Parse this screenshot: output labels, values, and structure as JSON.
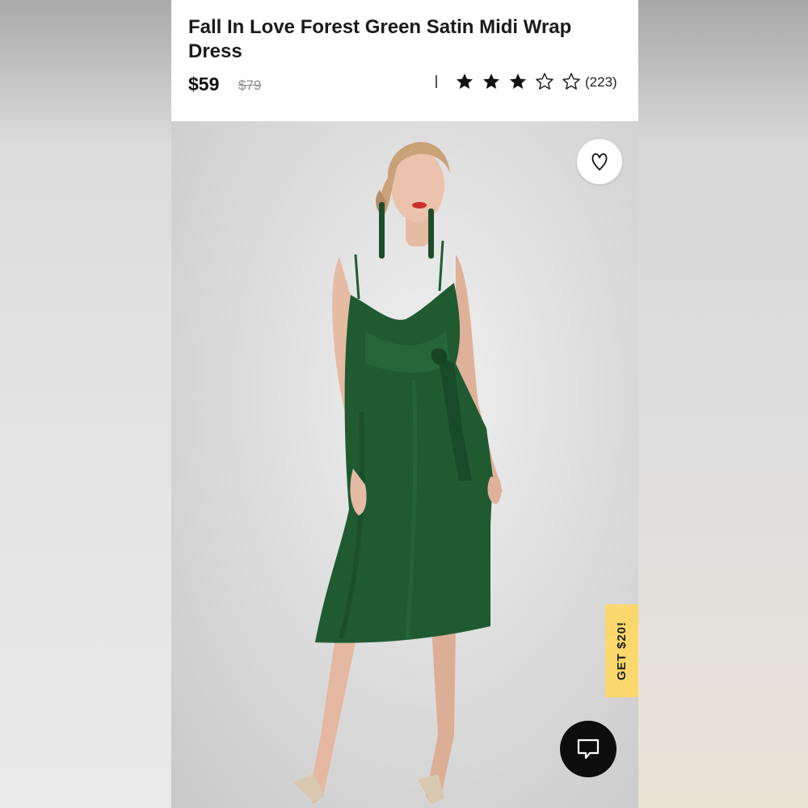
{
  "product": {
    "title": "Fall In Love Forest Green Satin Midi Wrap Dress",
    "price": "$59",
    "original_price": "$79",
    "rating_stars": 3,
    "rating_max": 5,
    "review_count": "(223)"
  },
  "promo": {
    "label": "GET $20!"
  },
  "icons": {
    "wishlist": "heart-icon",
    "chat": "chat-bubble-icon",
    "star_filled": "star-filled-icon",
    "star_empty": "star-outline-icon"
  },
  "colors": {
    "dress": "#1f5a31",
    "promo_bg": "#fbd86b",
    "chat_bg": "#0d0d0d"
  }
}
